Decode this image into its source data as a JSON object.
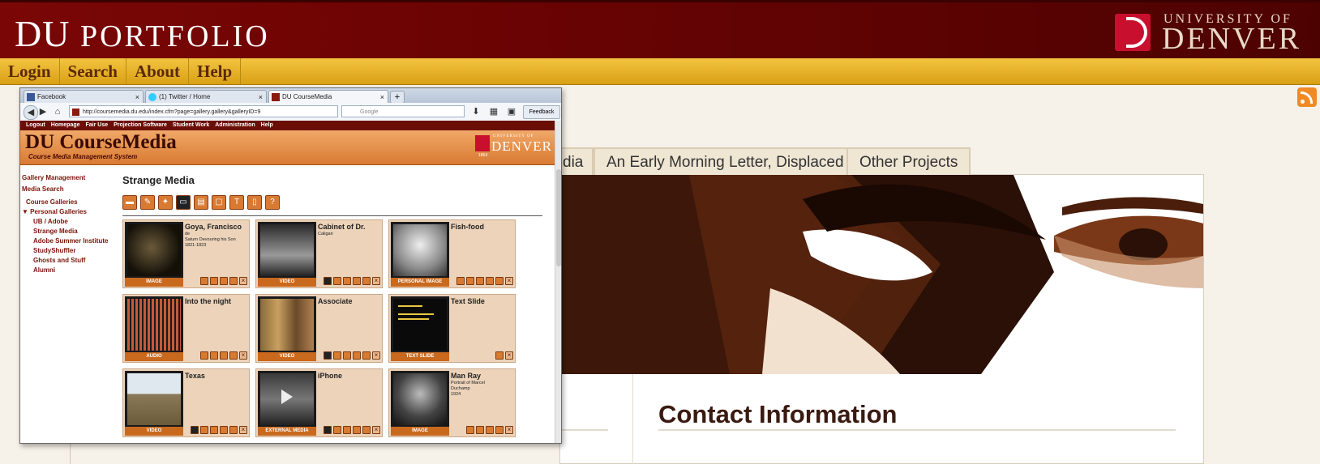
{
  "site": {
    "title_big": "DU",
    "title_rest": "PORTFOLIO",
    "logo_university": "UNIVERSITY OF",
    "logo_denver": "DENVER",
    "nav": [
      "Login",
      "Search",
      "About",
      "Help"
    ],
    "tabs": [
      "dia",
      "An Early Morning Letter, Displaced",
      "Other Projects"
    ],
    "contact_title": "Contact Information"
  },
  "browser": {
    "tabs": [
      {
        "label": "Facebook",
        "close": "×"
      },
      {
        "label": "(1) Twitter / Home",
        "close": "×"
      },
      {
        "label": "DU CourseMedia",
        "close": "×"
      }
    ],
    "new_tab": "+",
    "url": "http://coursemedia.du.edu/index.cfm?page=gallery.gallery&galleryID=9",
    "search_placeholder": "Google",
    "feedback": "Feedback"
  },
  "coursemedia": {
    "nav": [
      "Logout",
      "Homepage",
      "Fair Use",
      "Projection Software",
      "Student Work",
      "Administration",
      "Help"
    ],
    "title": "DU CourseMedia",
    "subtitle": "Course Media Management System",
    "logo_university": "UNIVERSITY OF",
    "logo_denver": "DENVER",
    "logo_year": "1864",
    "sidebar": [
      {
        "label": "Gallery Management"
      },
      {
        "label": "Media Search"
      },
      {
        "label": "Course Galleries"
      },
      {
        "label": "▼ Personal Galleries"
      },
      {
        "label": "UB / Adobe"
      },
      {
        "label": "Strange Media"
      },
      {
        "label": "Adobe Summer Institute"
      },
      {
        "label": "StudyShuffler"
      },
      {
        "label": "Ghosts and Stuff"
      },
      {
        "label": "Alumni"
      }
    ],
    "gallery_title": "Strange Media",
    "toolbar_icons": [
      "image-icon",
      "pencil-icon",
      "tag-icon",
      "monitor-icon",
      "export-icon",
      "slides-icon",
      "text-icon",
      "book-icon",
      "help-icon"
    ],
    "cards": [
      {
        "title": "Goya, Francisco",
        "sub": "de\nSaturn Devouring his Son\n1821-1823",
        "type": "IMAGE"
      },
      {
        "title": "Cabinet of Dr.",
        "sub": "Caligari",
        "type": "VIDEO"
      },
      {
        "title": "Fish-food",
        "sub": "",
        "type": "PERSONAL IMAGE"
      },
      {
        "title": "Into the night",
        "sub": "",
        "type": "AUDIO"
      },
      {
        "title": "Associate",
        "sub": "",
        "type": "VIDEO"
      },
      {
        "title": "Text Slide",
        "sub": "",
        "type": "TEXT SLIDE"
      },
      {
        "title": "Texas",
        "sub": "",
        "type": "VIDEO"
      },
      {
        "title": "iPhone",
        "sub": "",
        "type": "EXTERNAL MEDIA"
      },
      {
        "title": "Man Ray",
        "sub": "Portrait of Marcel\nDuchamp\n1924",
        "type": "IMAGE"
      }
    ]
  }
}
